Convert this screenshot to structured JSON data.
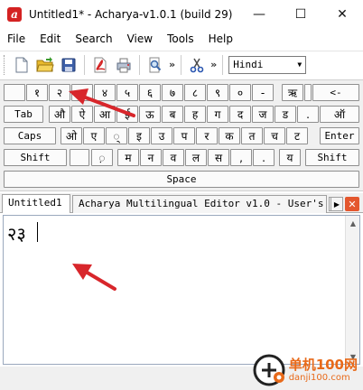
{
  "window": {
    "title": "Untitled1* - Acharya-v1.0.1 (build 29)",
    "app_icon_letter": "a",
    "minimize": "—",
    "maximize": "☐",
    "close": "✕"
  },
  "menu": [
    "File",
    "Edit",
    "Search",
    "View",
    "Tools",
    "Help"
  ],
  "toolbar": {
    "language": "Hindi",
    "overflow": "»"
  },
  "keyboard": {
    "row1": [
      "",
      "१",
      "२",
      "३",
      "४",
      "५",
      "६",
      "७",
      "८",
      "९",
      "०",
      "-",
      "ऋ",
      "",
      "<-"
    ],
    "row2": [
      "Tab",
      "औ",
      "ऐ",
      "आ",
      "ई",
      "ऊ",
      "ब",
      "ह",
      "ग",
      "द",
      "ज",
      "ड",
      ".",
      "ऑ"
    ],
    "row3": [
      "Caps",
      "ओ",
      "ए",
      "्",
      "इ",
      "उ",
      "प",
      "र",
      "क",
      "त",
      "च",
      "ट",
      "Enter"
    ],
    "row4": [
      "Shift",
      "",
      "़",
      "म",
      "न",
      "व",
      "ल",
      "स",
      ",",
      ".",
      "य",
      "Shift"
    ],
    "space": "Space"
  },
  "tabs": {
    "active": "Untitled1",
    "second": "Acharya Multilingual Editor v1.0 - User's M",
    "prev": "◀",
    "next": "▶",
    "close": "✕"
  },
  "editor": {
    "content": "२३"
  },
  "watermark": {
    "brand": "单机100网",
    "url": "danji100.com"
  },
  "colors": {
    "accent_red": "#d42222",
    "arrow_red": "#d8262b",
    "watermark_orange": "#e86a1a"
  }
}
